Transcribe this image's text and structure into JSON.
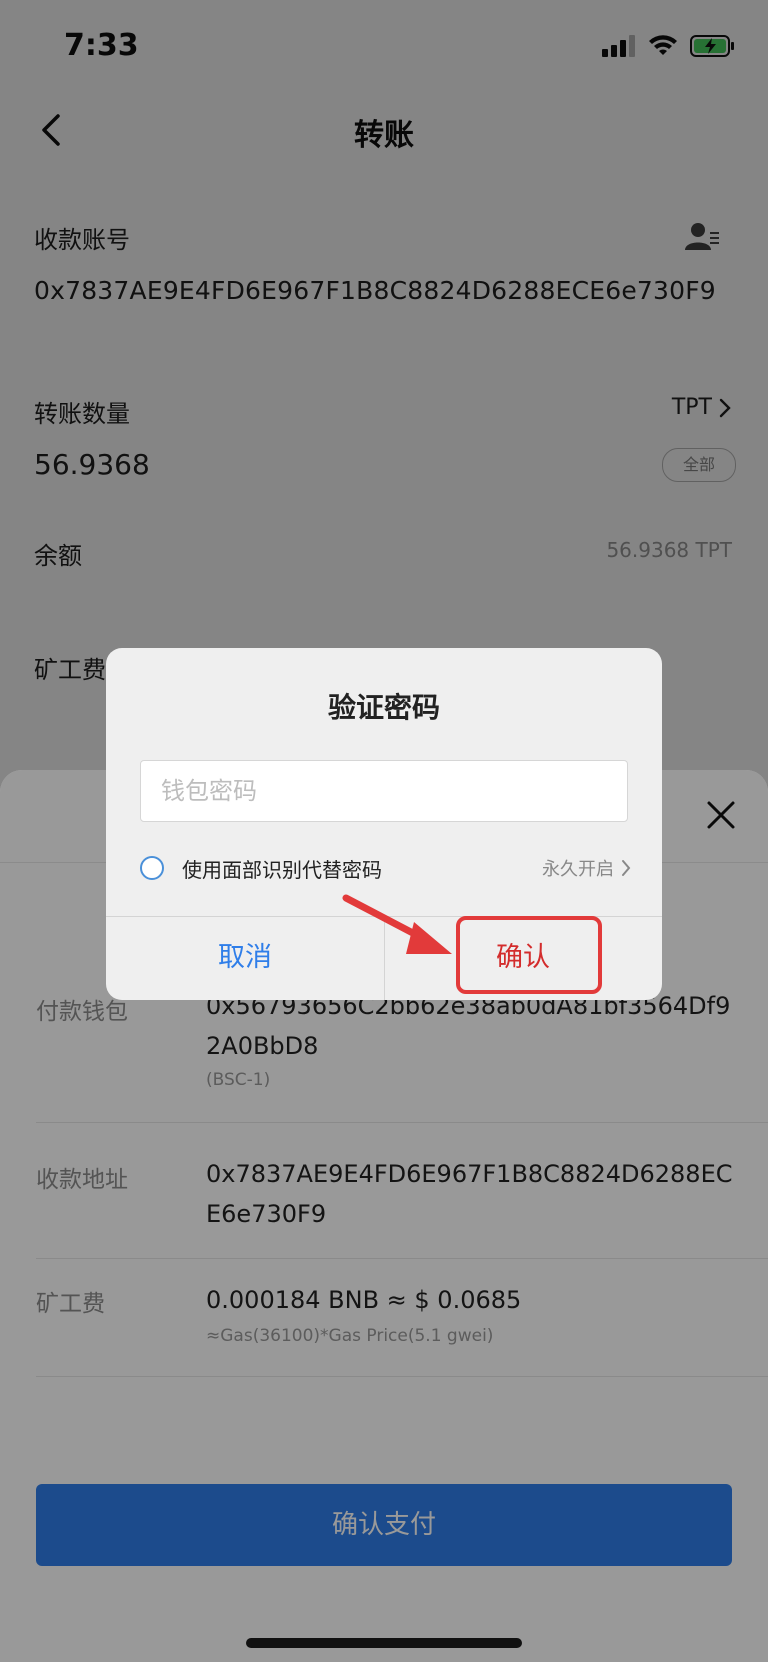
{
  "status_bar": {
    "time": "7:33"
  },
  "nav": {
    "title": "转账"
  },
  "form": {
    "receiver_label": "收款账号",
    "receiver_address": "0x7837AE9E4FD6E967F1B8C8824D6288ECE6e730F9",
    "amount_label": "转账数量",
    "token": "TPT",
    "amount_value": "56.9368",
    "all_label": "全部",
    "balance_label": "余额",
    "balance_value": "56.9368 TPT",
    "fee_label": "矿工费"
  },
  "sheet": {
    "rows": [
      {
        "label": "付款钱包",
        "value": "0x56793656C2bb62e38ab0dA81bf3564Df92A0BbD8",
        "sub": "(BSC-1)"
      },
      {
        "label": "收款地址",
        "value": "0x7837AE9E4FD6E967F1B8C8824D6288ECE6e730F9",
        "sub": ""
      },
      {
        "label": "矿工费",
        "value": "0.000184 BNB ≈ $ 0.0685",
        "sub": "≈Gas(36100)*Gas Price(5.1 gwei)"
      }
    ],
    "pay_button": "确认支付"
  },
  "dialog": {
    "title": "验证密码",
    "password_placeholder": "钱包密码",
    "face_id_label": "使用面部识别代替密码",
    "face_id_option": "永久开启",
    "cancel": "取消",
    "confirm": "确认"
  },
  "colors": {
    "primary": "#2f7ee9",
    "highlight": "#e23a3a"
  }
}
